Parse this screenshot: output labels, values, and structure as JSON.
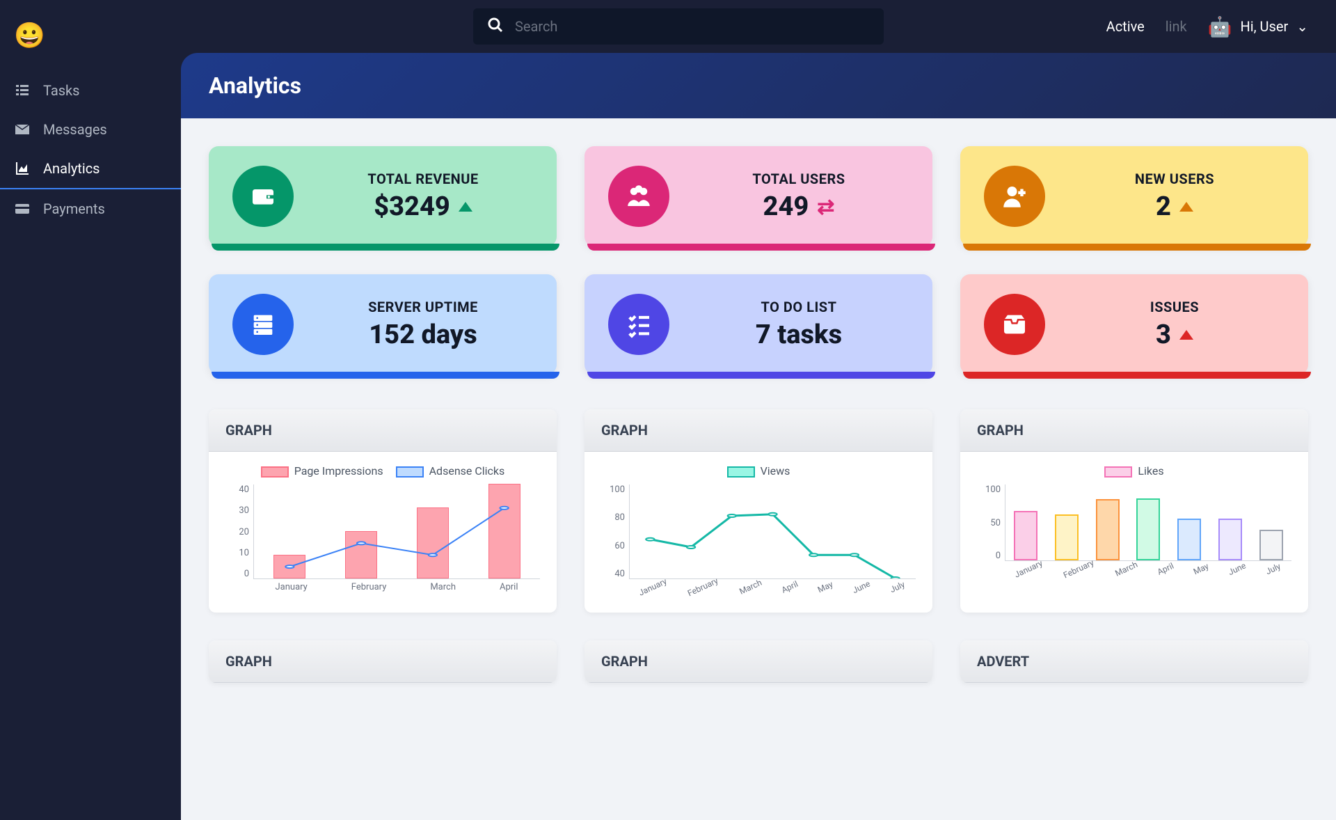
{
  "search": {
    "placeholder": "Search"
  },
  "topbar": {
    "active": "Active",
    "link": "link",
    "greeting": "Hi, User"
  },
  "sidebar": {
    "items": [
      {
        "label": "Tasks"
      },
      {
        "label": "Messages"
      },
      {
        "label": "Analytics"
      },
      {
        "label": "Payments"
      }
    ]
  },
  "page": {
    "title": "Analytics"
  },
  "stats": [
    {
      "label": "TOTAL REVENUE",
      "value": "$3249"
    },
    {
      "label": "TOTAL USERS",
      "value": "249"
    },
    {
      "label": "NEW USERS",
      "value": "2"
    },
    {
      "label": "SERVER UPTIME",
      "value": "152 days"
    },
    {
      "label": "TO DO LIST",
      "value": "7 tasks"
    },
    {
      "label": "ISSUES",
      "value": "3"
    }
  ],
  "graphs": {
    "titles": [
      "GRAPH",
      "GRAPH",
      "GRAPH",
      "GRAPH",
      "GRAPH",
      "ADVERT"
    ],
    "legends": {
      "impressions": "Page Impressions",
      "adsense": "Adsense Clicks",
      "views": "Views",
      "likes": "Likes"
    }
  },
  "chart_data": [
    {
      "type": "bar+line",
      "categories": [
        "January",
        "February",
        "March",
        "April"
      ],
      "series": [
        {
          "name": "Page Impressions",
          "type": "bar",
          "values": [
            10,
            20,
            30,
            40
          ]
        },
        {
          "name": "Adsense Clicks",
          "type": "line",
          "values": [
            5,
            15,
            10,
            30
          ]
        }
      ],
      "ylim": [
        0,
        40
      ],
      "yticks": [
        0,
        10,
        20,
        30,
        40
      ]
    },
    {
      "type": "line",
      "categories": [
        "January",
        "February",
        "March",
        "April",
        "May",
        "June",
        "July"
      ],
      "series": [
        {
          "name": "Views",
          "values": [
            65,
            60,
            80,
            81,
            55,
            55,
            40
          ]
        }
      ],
      "ylim": [
        40,
        100
      ],
      "yticks": [
        40,
        60,
        80,
        100
      ]
    },
    {
      "type": "bar",
      "categories": [
        "January",
        "February",
        "March",
        "April",
        "May",
        "June",
        "July"
      ],
      "series": [
        {
          "name": "Likes",
          "values": [
            65,
            60,
            80,
            81,
            55,
            55,
            40
          ]
        }
      ],
      "ylim": [
        0,
        100
      ],
      "yticks": [
        0,
        50,
        100
      ]
    }
  ]
}
